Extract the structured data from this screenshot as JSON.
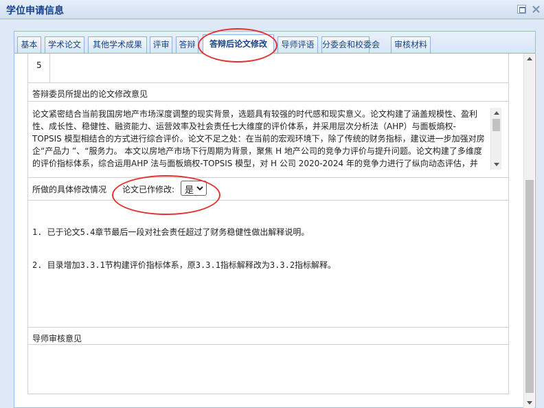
{
  "window": {
    "title": "学位申请信息"
  },
  "tabs": [
    {
      "label": "基本",
      "active": false
    },
    {
      "label": "学术论文",
      "active": false
    },
    {
      "label": "其他学术成果",
      "active": false
    },
    {
      "label": "评审",
      "active": false
    },
    {
      "label": "答辩",
      "active": false
    },
    {
      "label": "答辩后论文修改",
      "active": true
    },
    {
      "label": "导师评语",
      "active": false
    },
    {
      "label": "分委会和校委会",
      "active": false
    },
    {
      "label": "审核材料",
      "active": false
    }
  ],
  "form": {
    "row_number": "5",
    "committee_label": "答辩委员所提出的论文修改意见",
    "committee_comments": [
      "论文紧密结合当前我国房地产市场深度调整的现实背景，选题具有较强的时代感和现实意义。论文构建了涵盖规模性、盈利",
      "性、成长性、稳健性、融资能力、运营效率及社会责任七大维度的评价体系，并采用层次分析法（AHP）与面板熵权-",
      "TOPSIS 模型相结合的方式进行综合评价。论文不足之处：在当前的宏观环境下，除了传统的财务指标，建议进一步加强对房",
      "企“产品力 ”、“服务力。 本文以房地产市场下行周期为背景，聚焦 H 地产公司的竞争力评价与提升问题。论文构建了多维度",
      "的评价指标体系，综合运用AHP 法与面板熵权-TOPSIS 模型，对 H 公司 2020-2024 年的竞争力进行了纵向动态评估，并"
    ],
    "modification_label": "所做的具体修改情况",
    "modified_label": "论文已作修改:",
    "modified_value": "是",
    "modifications": [
      "1. 已于论文5.4章节最后一段对社会责任超过了财务稳健性做出解释说明。",
      "2. 目录增加3.3.1节构建评价指标体系，原3.3.1指标解释改为3.3.2指标解释。"
    ],
    "advisor_label": "导师审核意见"
  },
  "colors": {
    "accent": "#15428b",
    "annotation": "#e53030",
    "border": "#99bbe8"
  }
}
